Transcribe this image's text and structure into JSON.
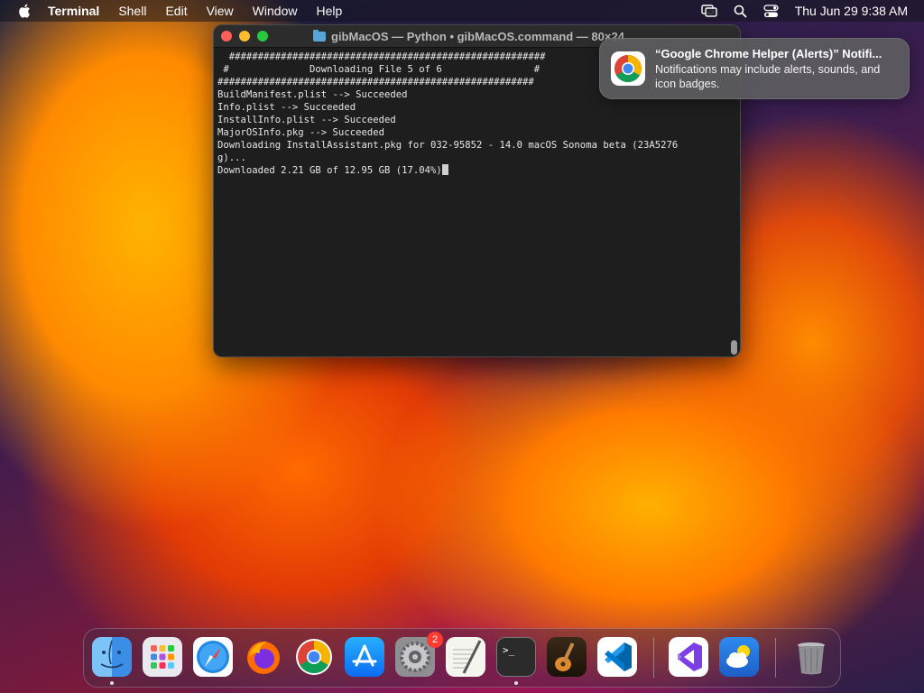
{
  "menubar": {
    "app_name": "Terminal",
    "items": [
      "Shell",
      "Edit",
      "View",
      "Window",
      "Help"
    ],
    "clock": "Thu Jun 29  9:38 AM"
  },
  "terminal": {
    "title": "gibMacOS — Python • gibMacOS.command — 80×24",
    "lines": [
      "  #######################################################",
      " #              Downloading File 5 of 6                #",
      "#######################################################",
      "",
      "BuildManifest.plist --> Succeeded",
      "Info.plist --> Succeeded",
      "InstallInfo.plist --> Succeeded",
      "MajorOSInfo.pkg --> Succeeded",
      "",
      "Downloading InstallAssistant.pkg for 032-95852 - 14.0 macOS Sonoma beta (23A5276",
      "g)...",
      "",
      "Downloaded 2.21 GB of 12.95 GB (17.04%)"
    ]
  },
  "notification": {
    "title": "“Google Chrome Helper (Alerts)” Notifi...",
    "body": "Notifications may include alerts, sounds, and icon badges."
  },
  "dock": {
    "items": [
      {
        "name": "finder",
        "running": true
      },
      {
        "name": "launchpad",
        "running": false
      },
      {
        "name": "safari",
        "running": false
      },
      {
        "name": "firefox",
        "running": false
      },
      {
        "name": "google-chrome",
        "running": false
      },
      {
        "name": "app-store",
        "running": false
      },
      {
        "name": "system-settings",
        "running": false,
        "badge": "2"
      },
      {
        "name": "textedit",
        "running": false
      },
      {
        "name": "terminal",
        "running": true
      },
      {
        "name": "garageband",
        "running": false
      },
      {
        "name": "visual-studio-code",
        "running": false
      },
      {
        "name": "visual-studio",
        "running": false
      },
      {
        "name": "weather",
        "running": false
      },
      {
        "name": "trash",
        "running": false
      }
    ],
    "colors": {
      "finder": "#3a8ee6",
      "safari": "#1e88e5",
      "firefox": "#ff6d00",
      "app_store": "#1a8cff",
      "terminal": "#2b2b2b",
      "vscode": "#ffffff",
      "visual_studio": "#ffffff",
      "weather": "#2f6fd6"
    }
  }
}
